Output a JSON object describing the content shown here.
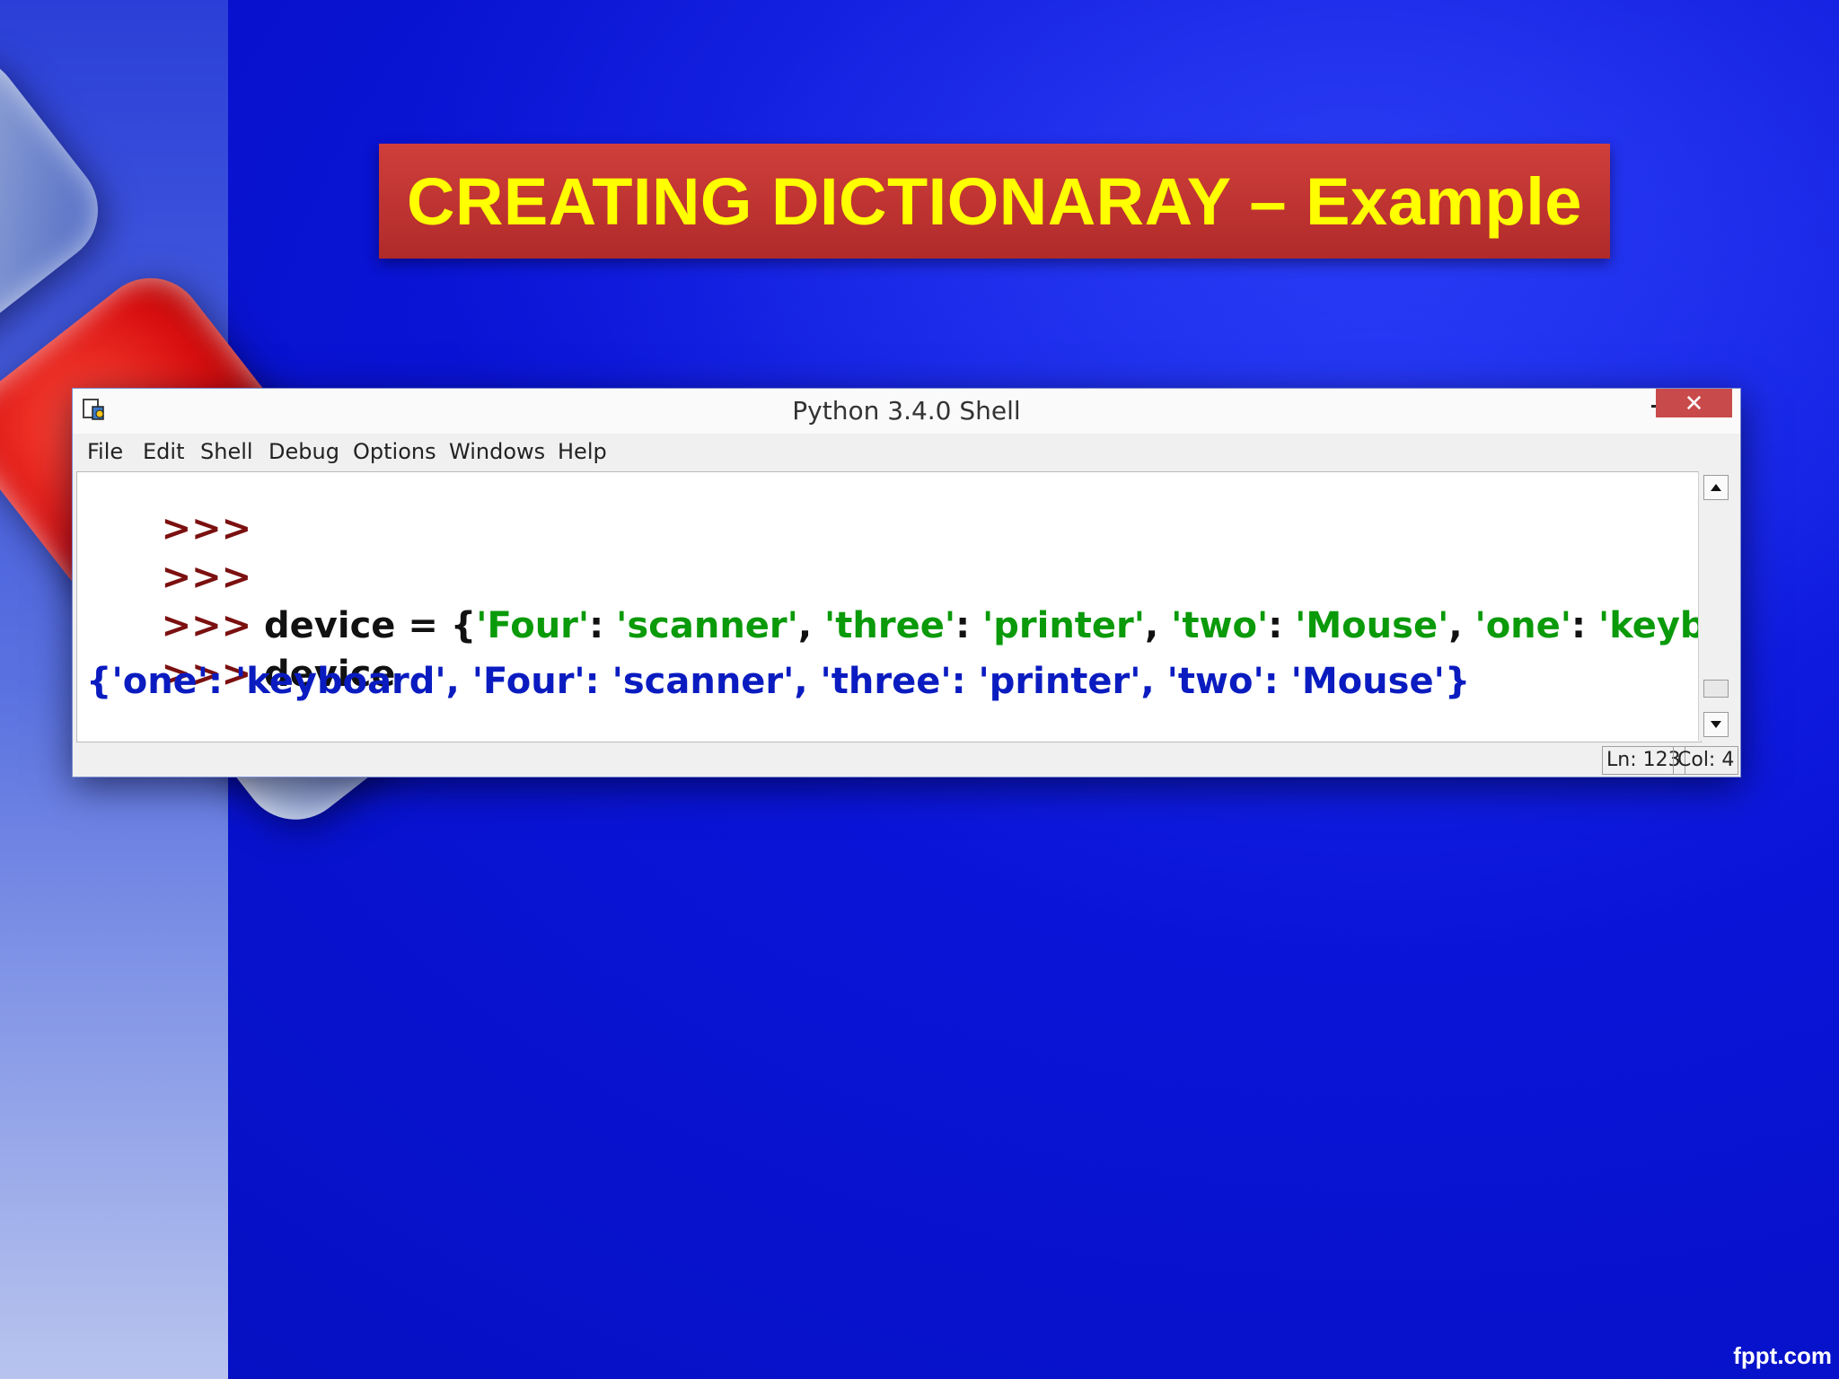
{
  "slide": {
    "title": "CREATING DICTIONARAY – Example",
    "watermark": "fppt.com"
  },
  "window": {
    "title": "Python 3.4.0 Shell",
    "close_glyph": "✕",
    "menu": [
      "File",
      "Edit",
      "Shell",
      "Debug",
      "Options",
      "Windows",
      "Help"
    ],
    "status": {
      "line": "Ln: 123",
      "col": "Col: 4"
    }
  },
  "shell": {
    "prompt": ">>>",
    "lines": [
      {
        "prompt": ">>>",
        "code": ""
      },
      {
        "prompt": ">>>",
        "code": ""
      },
      {
        "prompt": ">>>",
        "parts": [
          {
            "t": " device = {",
            "c": "kw"
          },
          {
            "t": "'Four'",
            "c": "str"
          },
          {
            "t": ": ",
            "c": "kw"
          },
          {
            "t": "'scanner'",
            "c": "str"
          },
          {
            "t": ", ",
            "c": "kw"
          },
          {
            "t": "'three'",
            "c": "str"
          },
          {
            "t": ": ",
            "c": "kw"
          },
          {
            "t": "'printer'",
            "c": "str"
          },
          {
            "t": ", ",
            "c": "kw"
          },
          {
            "t": "'two'",
            "c": "str"
          },
          {
            "t": ": ",
            "c": "kw"
          },
          {
            "t": "'Mouse'",
            "c": "str"
          },
          {
            "t": ", ",
            "c": "kw"
          },
          {
            "t": "'one'",
            "c": "str"
          },
          {
            "t": ": ",
            "c": "kw"
          },
          {
            "t": "'keyboard'",
            "c": "str"
          },
          {
            "t": "}",
            "c": "kw"
          }
        ]
      },
      {
        "prompt": ">>>",
        "code": " device"
      },
      {
        "output": "{'one': 'keyboard', 'Four': 'scanner', 'three': 'printer', 'two': 'Mouse'}"
      },
      {
        "prompt": ">>>",
        "code": ""
      }
    ]
  },
  "colors": {
    "background": "#0a14d8",
    "title_bg": "#b02a2a",
    "title_text": "#ffff00",
    "prompt": "#7b1010",
    "string": "#0a9a0a",
    "output": "#0a1cc0"
  }
}
